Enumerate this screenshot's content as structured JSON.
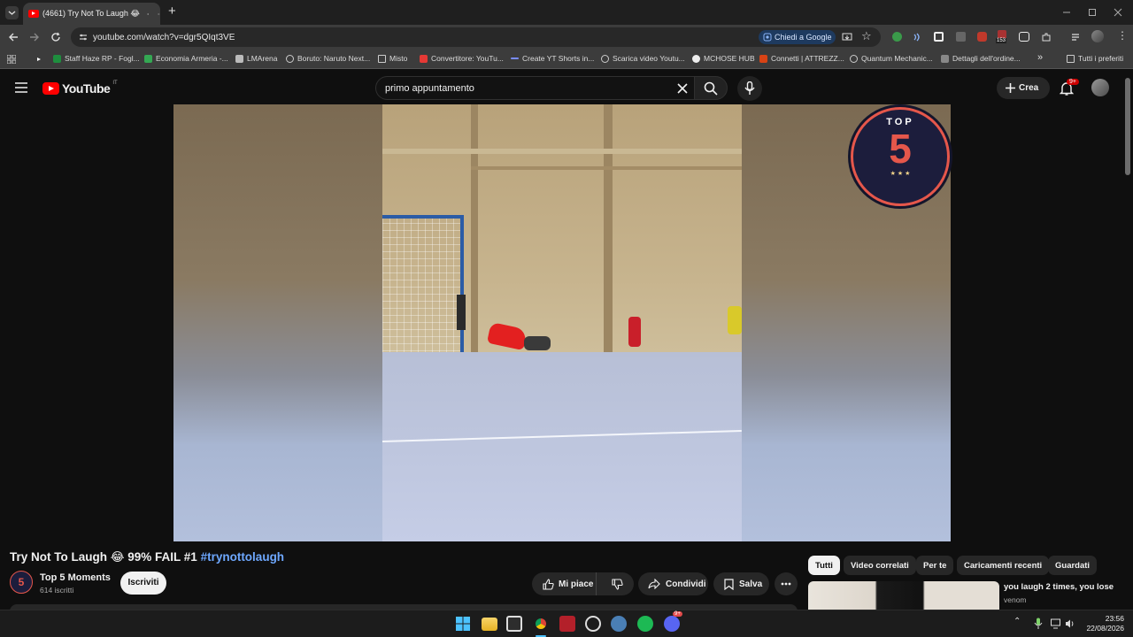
{
  "browser": {
    "tab_title": "(4661) Try Not To Laugh 😂",
    "new_tab_symbol": "+",
    "url": "youtube.com/watch?v=dgr5QIqt3VE",
    "ask_google": "Chiedi a Google",
    "extension_badge": "153",
    "bookmarks": [
      "Staff Haze RP - Fogl...",
      "Economia Armeria -...",
      "LMArena",
      "Boruto: Naruto Next...",
      "Misto",
      "Convertitore: YouTu...",
      "Create YT Shorts in...",
      "Scarica video Youtu...",
      "MCHOSE HUB",
      "Connetti | ATTREZZ...",
      "Quantum Mechanic...",
      "Dettagli dell'ordine...",
      "Tutti i preferiti"
    ]
  },
  "youtube": {
    "logo_text": "YouTube",
    "country_code": "IT",
    "search_value": "primo appuntamento",
    "create_label": "Crea",
    "notifications_badge": "9+"
  },
  "video": {
    "overlay_top": "TOP",
    "overlay_number": "5",
    "overlay_stars": "★ ★ ★",
    "watermark_number": "5",
    "title_main": "Try Not To Laugh 😂 99% FAIL #1 ",
    "title_hashtag": "#trynottolaugh"
  },
  "channel": {
    "avatar_text": "5",
    "name": "Top 5 Moments",
    "subscribers": "614 iscritti",
    "subscribe_label": "Iscriviti"
  },
  "actions": {
    "like_label": "Mi piace",
    "share_label": "Condividi",
    "save_label": "Salva"
  },
  "chips": [
    "Tutti",
    "Video correlati",
    "Per te",
    "Caricamenti recenti",
    "Guardati"
  ],
  "recommendation": {
    "title": "you laugh 2 times, you lose",
    "channel": "venom"
  },
  "taskbar": {
    "time": "23:56",
    "date": "22/08/2026",
    "discord_badge": "9+"
  },
  "colors": {
    "accent_red": "#ff0000",
    "badge_red": "#e5574b",
    "hashtag_blue": "#6ea8ff",
    "background": "#0f0f0f"
  }
}
